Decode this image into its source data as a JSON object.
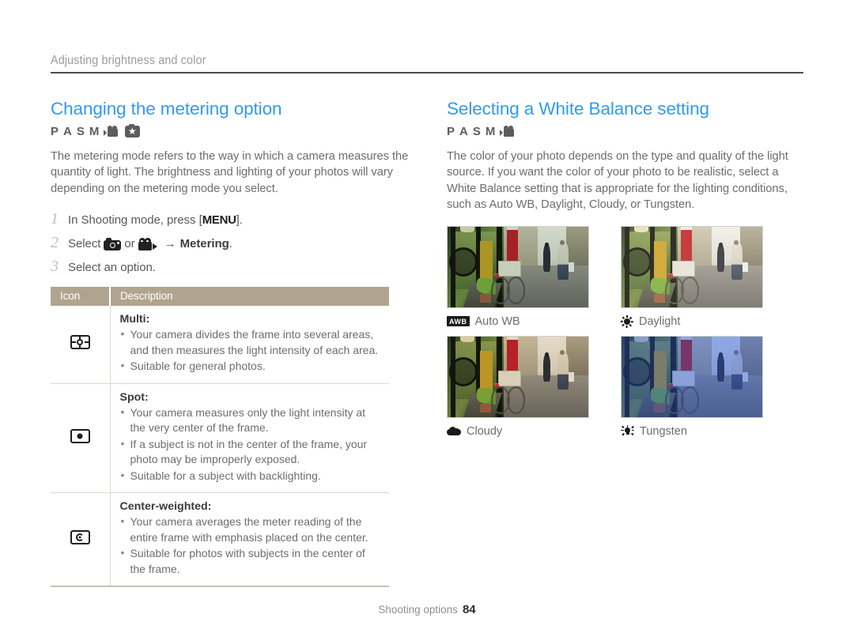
{
  "running_head": {
    "text": "Adjusting brightness and color"
  },
  "left_column": {
    "title": "Changing the metering option",
    "modes": [
      "P",
      "A",
      "S",
      "M"
    ],
    "mode_icons": [
      "video-icon",
      "smart-auto-star-icon"
    ],
    "intro": "The metering mode refers to the way in which a camera measures the quantity of light. The brightness and lighting of your photos will vary depending on the metering mode you select.",
    "steps": [
      {
        "num": "1",
        "before": "In Shooting mode, press [",
        "key": "MENU",
        "after": "]."
      },
      {
        "num": "2",
        "before": "Select",
        "middle": "or",
        "arrow": "→",
        "bold": "Metering",
        "after": "."
      },
      {
        "num": "3",
        "before": "Select an option."
      }
    ],
    "table": {
      "headers": [
        "Icon",
        "Description"
      ],
      "rows": [
        {
          "icon": "metering-multi-icon",
          "title": "Multi:",
          "bullets": [
            "Your camera divides the frame into several areas, and then measures the light intensity of each area.",
            "Suitable for general photos."
          ]
        },
        {
          "icon": "metering-spot-icon",
          "title": "Spot:",
          "bullets": [
            "Your camera measures only the light intensity at the very center of the frame.",
            "If a subject is not in the center of the frame, your photo may be improperly exposed.",
            "Suitable for a subject with backlighting."
          ]
        },
        {
          "icon": "metering-center-weighted-icon",
          "title": "Center-weighted:",
          "bullets": [
            "Your camera averages the meter reading of the entire frame with emphasis placed on the center.",
            "Suitable for photos with subjects in the center of the frame."
          ]
        }
      ]
    }
  },
  "right_column": {
    "title": "Selecting a White Balance setting",
    "modes": [
      "P",
      "A",
      "S",
      "M"
    ],
    "mode_icons": [
      "video-icon"
    ],
    "intro": "The color of your photo depends on the type and quality of the light source. If you want the color of your photo to be realistic, select a White Balance setting that is appropriate for the lighting conditions, such as Auto WB, Daylight, Cloudy, or Tungsten.",
    "samples": [
      {
        "label": "Auto WB",
        "icon": "awb-icon",
        "icon_text": "AWB"
      },
      {
        "label": "Daylight",
        "icon": "sun-icon",
        "icon_text": ""
      },
      {
        "label": "Cloudy",
        "icon": "cloud-icon",
        "icon_text": ""
      },
      {
        "label": "Tungsten",
        "icon": "lightbulb-icon",
        "icon_text": ""
      }
    ]
  },
  "footer": {
    "label": "Shooting options",
    "page": "84"
  },
  "colors": {
    "heading_blue": "#2f9bf0",
    "table_header_tan": "#b0a48f",
    "body_gray": "#6d6d6d",
    "rule_dark": "#4f4b4c"
  }
}
